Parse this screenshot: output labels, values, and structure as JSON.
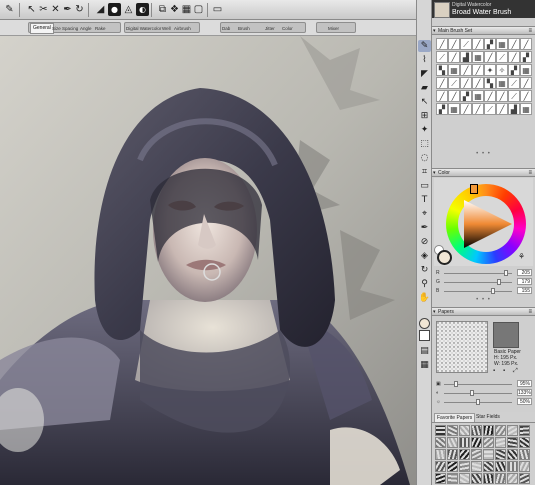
{
  "toolbar": {
    "icons": [
      "brush-tool-icon",
      "arrow-icon",
      "scissors-icon",
      "tools-icon",
      "pen-icon",
      "rotate-icon",
      "fill-icon",
      "mask-icon",
      "triangle-icon",
      "layer-icon",
      "mirror-icon",
      "color-icon",
      "grid-icon",
      "shape-icon",
      "minus-icon"
    ]
  },
  "property_bar": {
    "groups": [
      {
        "tabs": [
          "General",
          "Size",
          "Spacing",
          "Angle",
          "Rake"
        ]
      },
      {
        "tabs": [
          "Digital Watercolor",
          "Well",
          "Airbrush"
        ]
      },
      {
        "tabs": [
          "Dab",
          "Brush",
          "Jitter",
          "Color"
        ]
      },
      {
        "tabs": [
          "Mixer"
        ]
      }
    ],
    "active_tab": "General"
  },
  "toolbox": {
    "tools": [
      "brush",
      "dropper",
      "paint-bucket",
      "eraser",
      "layer-adjuster",
      "transform",
      "magic-wand",
      "rect-select",
      "lasso",
      "crop",
      "shape",
      "text",
      "perspective",
      "pen",
      "mirror",
      "divine-proportion",
      "clone",
      "cloner",
      "rotate",
      "zoom",
      "hand",
      "grabber",
      "select",
      "pen-shape",
      "circle"
    ],
    "active_tool": "brush",
    "main_color": "#f1e6d5",
    "secondary_color": "#ffffff"
  },
  "brush_selector": {
    "category": "Digital Watercolor",
    "variant": "Broad Water Brush"
  },
  "panels": {
    "brush_library_title": "Main Brush Set",
    "color_title": "Color",
    "papers_title": "Papers",
    "favorite_tabs": [
      "Favorite Papers",
      "Star Fields"
    ]
  },
  "color": {
    "hue_color": "#f08a34",
    "r": "205",
    "g": "179",
    "b": "155"
  },
  "paper": {
    "name": "Basic Paper",
    "height": "H: 195 Px.",
    "width": "W: 195 Px.",
    "scale": "95%",
    "contrast": "133%",
    "brightness": "50%"
  }
}
